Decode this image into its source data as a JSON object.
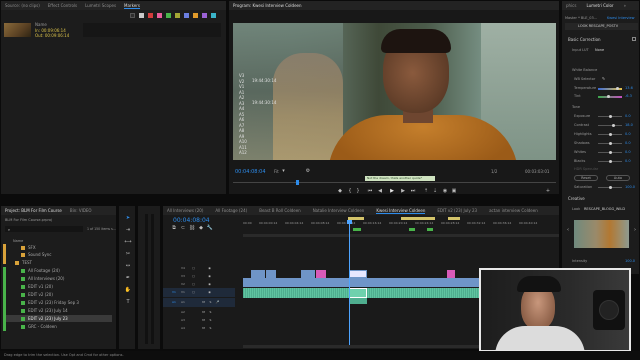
{
  "top_left": {
    "tabs": [
      "Source: (no clips)",
      "Effect Controls",
      "Lumetri Scopes",
      "Markers"
    ],
    "active_tab": "Markers",
    "marker_name_label": "Name",
    "marker_in": "In:  00:09:06:14",
    "marker_out": "Out: 00:09:06:14",
    "marker_colors": [
      "#2e2e2e",
      "#c8c8c8",
      "#d23b3b",
      "#e85d9b",
      "#49b34a",
      "#a4a634",
      "#6b7ee0",
      "#e09a2a",
      "#9b62d6",
      "#3ab4c9",
      "#d8d06b"
    ]
  },
  "program": {
    "title": "Program: Kwesi Interview Coldeen",
    "track_labels": [
      "V3",
      "V2",
      "V1",
      "A1",
      "A2",
      "A3",
      "A4",
      "A5",
      "A6",
      "A7",
      "A8",
      "A9",
      "A10",
      "A11",
      "A12"
    ],
    "overlay_tc": "19:44:30:14",
    "overlay_tc2": "19:44:30:14",
    "timecode": "00:04:08:04",
    "fit": "Fit",
    "zoom": "1/2",
    "duration": "00:03:03:01",
    "marker_tooltip": "Not the dream, thats another quote*"
  },
  "lumetri": {
    "tabs": [
      "phics",
      "Lumetri Color",
      "»"
    ],
    "master_line": "Master * BLE_03...",
    "master_link": "Kwesi Interview",
    "lut_label": "LOOK RESCAPE_POSTV",
    "basic_correction": "Basic Correction",
    "input_lut_label": "Input LUT",
    "input_lut_value": "None",
    "white_balance": "White Balance",
    "wb_selector": "WB Selector",
    "temperature": "Temperature",
    "temperature_value": "13.6",
    "tint": "Tint",
    "tint_value": "-6.3",
    "tone": "Tone",
    "tone_rows": [
      {
        "label": "Exposure",
        "value": "0.0"
      },
      {
        "label": "Contrast",
        "value": "18.0"
      },
      {
        "label": "Highlights",
        "value": "0.0"
      },
      {
        "label": "Shadows",
        "value": "0.0"
      },
      {
        "label": "Whites",
        "value": "0.0"
      },
      {
        "label": "Blacks",
        "value": "0.0"
      }
    ],
    "hdr_specular": "HDR Specular",
    "reset": "Reset",
    "auto": "Auto",
    "saturation": "Saturation",
    "saturation_value": "100.0",
    "creative": "Creative",
    "look_label": "Look",
    "look_value": "RESCAPE_BLOGG_WILD",
    "intensity": "Intensity",
    "intensity_value": "100.0"
  },
  "project": {
    "tabs": [
      "Project: BLM For Film Course",
      "Bin: VIDEO"
    ],
    "project_file": "BLM For Film Course.prproj",
    "items_count": "1 of 150 items s...",
    "name_header": "Name",
    "items": [
      {
        "name": "SFX",
        "color": "#d9a23a",
        "indent": 2
      },
      {
        "name": "Sound Sync",
        "color": "#d9a23a",
        "indent": 2
      },
      {
        "name": "TEST",
        "color": "#d9a23a",
        "indent": 1
      },
      {
        "name": "All Footage (24)",
        "color": "#49b34a",
        "indent": 2
      },
      {
        "name": "All Interviews (20)",
        "color": "#49b34a",
        "indent": 2
      },
      {
        "name": "EDIT v1 (20)",
        "color": "#49b34a",
        "indent": 2
      },
      {
        "name": "EDIT v2 (20)",
        "color": "#49b34a",
        "indent": 2
      },
      {
        "name": "EDIT v2 (23) Friday Sep 3",
        "color": "#49b34a",
        "indent": 2
      },
      {
        "name": "EDIT v2 (23) July 14",
        "color": "#49b34a",
        "indent": 2
      },
      {
        "name": "EDIT v2 (23) July 23",
        "color": "#49b34a",
        "indent": 2
      },
      {
        "name": "GRC - Coldeen",
        "color": "#49b34a",
        "indent": 2
      }
    ]
  },
  "timeline": {
    "tabs": [
      "All Interviews (20)",
      "All Footage (24)",
      "Beast B Roll Coldeen",
      "Natalie Interview Coldeen",
      "Kwesi Interview Coldeen",
      "EDIT v2 (23) July 23",
      "actan interview Coldeen"
    ],
    "active_tab": "Kwesi Interview Coldeen",
    "timecode": "00:04:08:04",
    "ruler": [
      "00:00",
      "00:04:00:14",
      "00:04:04:14",
      "00:04:08:14",
      "00:04:12:14",
      "00:04:16:14",
      "00:04:20:14",
      "00:04:24:14",
      "00:04:28:14",
      "00:04:32:14",
      "00:04:36:14",
      "00:04:40:14"
    ],
    "video_tracks": [
      "V4",
      "V3",
      "V2",
      "V1"
    ],
    "audio_tracks": [
      "A1",
      "A2",
      "A3",
      "A4"
    ],
    "track_labels_extra": [
      "V1",
      "A1"
    ]
  },
  "status": {
    "text": "Drag edge to trim the selection. Use Opt and Cmd for other options."
  },
  "colors": {
    "accent_blue": "#2d8ceb",
    "clip_blue": "#6f95c8",
    "clip_green": "#4fae8f",
    "clip_pink": "#d85ab8",
    "clip_yellow": "#d4c46a",
    "timeline_playhead": "#4ea4ff"
  }
}
